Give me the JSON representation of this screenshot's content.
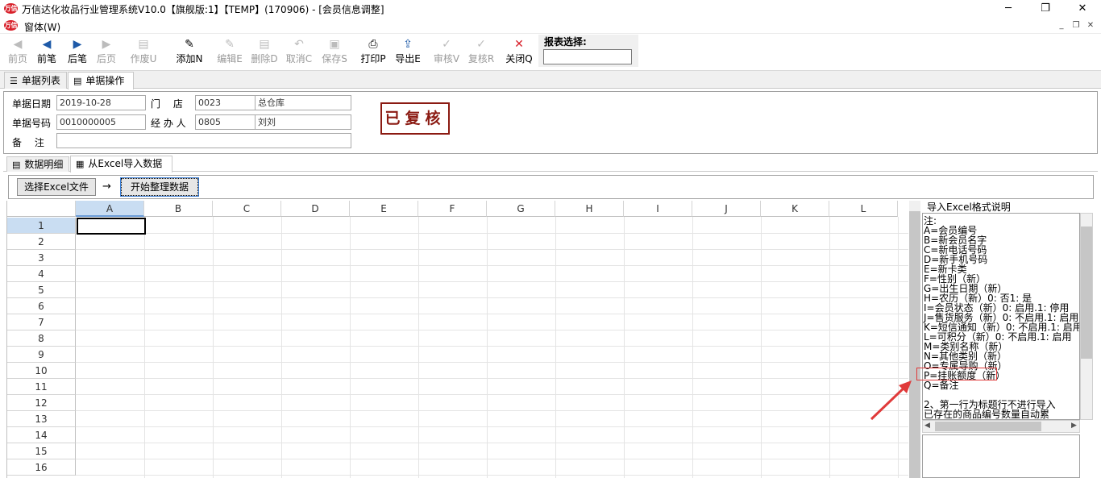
{
  "window": {
    "logo_text": "万信",
    "title": "万信达化妆品行业管理系统V10.0【旗舰版:1】【TEMP】(170906) - [会员信息调整]",
    "minimize": "─",
    "maximize": "❐",
    "close": "✕"
  },
  "menubar": {
    "menu": "窗体(W)",
    "mdi_min": "_",
    "mdi_restore": "❐",
    "mdi_close": "✕"
  },
  "toolbar": {
    "buttons": [
      {
        "label": "前页",
        "icon": "◀",
        "enabled": false
      },
      {
        "label": "前笔",
        "icon": "◀",
        "enabled": true
      },
      {
        "label": "后笔",
        "icon": "▶",
        "enabled": true
      },
      {
        "label": "后页",
        "icon": "▶",
        "enabled": false
      },
      {
        "label": "作废U",
        "icon": "▤",
        "enabled": false
      },
      {
        "label": "添加N",
        "icon": "✎",
        "enabled": true
      },
      {
        "label": "编辑E",
        "icon": "✎",
        "enabled": false
      },
      {
        "label": "删除D",
        "icon": "▤",
        "enabled": false
      },
      {
        "label": "取消C",
        "icon": "↶",
        "enabled": false
      },
      {
        "label": "保存S",
        "icon": "▣",
        "enabled": false
      },
      {
        "label": "打印P",
        "icon": "⎙",
        "enabled": true
      },
      {
        "label": "导出E",
        "icon": "⇪",
        "enabled": true
      },
      {
        "label": "审核V",
        "icon": "✓",
        "enabled": false
      },
      {
        "label": "复核R",
        "icon": "✓",
        "enabled": false
      },
      {
        "label": "关闭Q",
        "icon": "✕",
        "enabled": true
      }
    ],
    "report_select_label": "报表选择:",
    "report_select_value": ""
  },
  "tabs_top": [
    {
      "label": "单据列表",
      "icon": "list-icon",
      "active": false
    },
    {
      "label": "单据操作",
      "icon": "document-icon",
      "active": true
    }
  ],
  "form": {
    "date_label": "单据日期",
    "date_value": "2019-10-28",
    "store_label": "门　 店",
    "store_code": "0023",
    "store_name": "总仓库",
    "number_label": "单据号码",
    "number_value": "0010000005",
    "handler_label": "经 办 人",
    "handler_code": "0805",
    "handler_name": "刘刘",
    "remark_label": "备　 注",
    "remark_value": "",
    "stamp": "已复核"
  },
  "tabs_inner": [
    {
      "label": "数据明细",
      "active": false
    },
    {
      "label": "从Excel导入数据",
      "active": true
    }
  ],
  "import": {
    "choose_button": "选择Excel文件",
    "arrow": "→",
    "start_button": "开始整理数据"
  },
  "grid": {
    "columns": [
      "A",
      "B",
      "C",
      "D",
      "E",
      "F",
      "G",
      "H",
      "I",
      "J",
      "K",
      "L"
    ],
    "rows": [
      "1",
      "2",
      "3",
      "4",
      "5",
      "6",
      "7",
      "8",
      "9",
      "10",
      "11",
      "12",
      "13",
      "14",
      "15",
      "16"
    ],
    "selected_cell": "A1"
  },
  "help": {
    "title": "导入Excel格式说明",
    "lines": [
      "注:",
      "A=会员编号",
      "B=新会员名字",
      "C=新电话号码",
      "D=新手机号码",
      "E=新卡类",
      "F=性别（新）",
      "G=出生日期（新）",
      "H=农历（新）0: 否1: 是",
      "I=会员状态（新）0: 启用.1: 停用",
      "J=售货服务（新）0: 不启用.1: 启用",
      "K=短信通知（新）0: 不启用.1: 启用",
      "L=可积分（新）0: 不启用.1: 启用",
      "M=类别名称（新）",
      "N=其他类别（新）",
      "O=专属导购（新）",
      "P=挂账额度（新）",
      "Q=备注",
      "",
      "    2、第一行为标题行不进行导入",
      "       已存在的商品编号数量自动累"
    ],
    "highlighted_line": "P=挂账额度（新）"
  }
}
